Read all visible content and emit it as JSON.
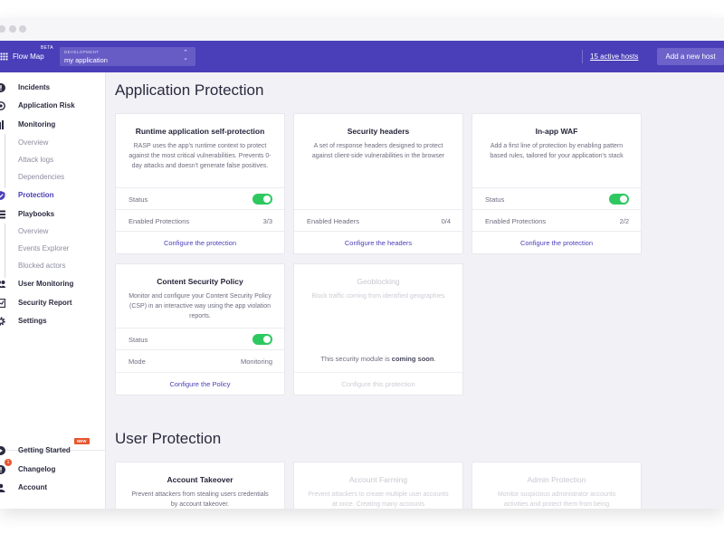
{
  "topbar": {
    "brand": "Flow Map",
    "beta": "BETA",
    "env_label": "DEVELOPMENT",
    "env_value": "my application",
    "hosts_link": "15 active hosts",
    "add_host": "Add a new host"
  },
  "sidebar": {
    "incidents": "Incidents",
    "app_risk": "Application Risk",
    "monitoring": "Monitoring",
    "overview1": "Overview",
    "attack_logs": "Attack logs",
    "dependencies": "Dependencies",
    "protection": "Protection",
    "playbooks": "Playbooks",
    "overview2": "Overview",
    "events_explorer": "Events Explorer",
    "blocked_actors": "Blocked actors",
    "user_monitoring": "User Monitoring",
    "security_report": "Security Report",
    "settings": "Settings",
    "getting_started": "Getting Started",
    "new_badge": "NEW",
    "changelog": "Changelog",
    "changelog_count": "1",
    "account": "Account"
  },
  "app_protection": {
    "title": "Application Protection",
    "rasp": {
      "title": "Runtime application self-protection",
      "desc": "RASP uses the app's runtime context to protect against the most critical vulnerabilities. Prevents 0-day attacks and doesn't generate false positives.",
      "status_label": "Status",
      "enabled_label": "Enabled Protections",
      "enabled_value": "3/3",
      "link": "Configure the protection"
    },
    "headers": {
      "title": "Security headers",
      "desc": "A set of response headers designed to protect against client-side vulnerabilities in the browser",
      "enabled_label": "Enabled Headers",
      "enabled_value": "0/4",
      "link": "Configure the headers"
    },
    "waf": {
      "title": "In-app WAF",
      "desc": "Add a first line of protection by enabling pattern based rules, tailored for your application's stack",
      "status_label": "Status",
      "enabled_label": "Enabled Protections",
      "enabled_value": "2/2",
      "link": "Configure the protection"
    },
    "csp": {
      "title": "Content Security Policy",
      "desc": "Monitor and configure your Content Security Policy (CSP) in an interactive way using the app violation reports.",
      "status_label": "Status",
      "mode_label": "Mode",
      "mode_value": "Monitoring",
      "link": "Configure the Policy"
    },
    "geo": {
      "title": "Geoblocking",
      "desc": "Block traffic coming from identified geographies",
      "soon_prefix": "This security module is",
      "soon_bold": "coming soon",
      "soon_suffix": ".",
      "link": "Configure this protection"
    }
  },
  "user_protection": {
    "title": "User Protection",
    "takeover": {
      "title": "Account Takeover",
      "desc": "Prevent attackers from stealing users credentials by account takeover."
    },
    "farming": {
      "title": "Account Farming",
      "desc": "Prevent attackers to create multiple user accounts at once. Creating many accounts"
    },
    "admin": {
      "title": "Admin Protection",
      "desc": "Monitor suspicious administrator accounts activities and protect them from being"
    }
  },
  "colors": {
    "brand": "#4a3fb8",
    "toggle_on": "#2ec861",
    "badge": "#e8552f"
  }
}
